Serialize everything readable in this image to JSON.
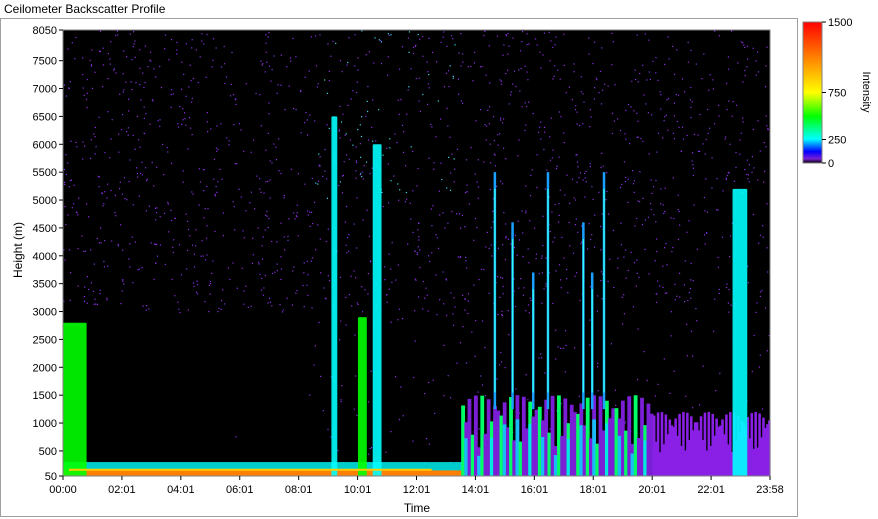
{
  "window": {
    "title": "Ceilometer Backscatter Profile"
  },
  "chart_data": {
    "type": "heatmap",
    "title": "Ceilometer Backscatter Profile",
    "xlabel": "Time",
    "ylabel": "Height (m)",
    "x_ticks": [
      "00:00",
      "02:01",
      "04:01",
      "06:01",
      "08:01",
      "10:01",
      "12:01",
      "14:01",
      "16:01",
      "18:01",
      "20:01",
      "22:01",
      "23:58"
    ],
    "y_ticks": [
      50,
      500,
      1000,
      1500,
      2000,
      2500,
      3000,
      3500,
      4000,
      4500,
      5000,
      5500,
      6000,
      6500,
      7000,
      7500,
      8050
    ],
    "ylim": [
      50,
      8050
    ],
    "xlim_hours": [
      0,
      23.97
    ],
    "colorbar": {
      "label": "Intensity",
      "ticks": [
        "1500",
        "750",
        "250",
        "0"
      ],
      "range": [
        0,
        1500
      ],
      "colors": [
        "#000000",
        "#7a1fd6",
        "#0000ff",
        "#00ffff",
        "#00ff00",
        "#ffff00",
        "#ff8000",
        "#ff0000"
      ]
    },
    "features": [
      {
        "name": "surface layer",
        "t_start": 0.0,
        "t_end": 14.0,
        "h_top": 150,
        "intensity": 900
      },
      {
        "name": "early residual plume",
        "t_start": 0.0,
        "t_end": 0.8,
        "h_top": 2800,
        "intensity": 300
      },
      {
        "name": "morning cloud base",
        "t_start": 10.0,
        "t_end": 10.3,
        "h_top": 2900,
        "intensity": 400
      },
      {
        "name": "virga streak A",
        "t_start": 9.1,
        "t_end": 9.3,
        "h_top": 6500,
        "intensity": 250
      },
      {
        "name": "virga streak B",
        "t_start": 10.5,
        "t_end": 10.8,
        "h_top": 6000,
        "intensity": 250
      },
      {
        "name": "afternoon boundary layer",
        "t_start": 13.5,
        "t_end": 20.0,
        "h_top": 1500,
        "intensity": 500
      },
      {
        "name": "afternoon convective streaks",
        "t_start": 14.5,
        "t_end": 19.0,
        "h_top": 5500,
        "intensity": 300
      },
      {
        "name": "evening residual layer",
        "t_start": 20.0,
        "t_end": 23.97,
        "h_top": 1200,
        "intensity": 60
      },
      {
        "name": "late high cloud",
        "t_start": 22.7,
        "t_end": 23.2,
        "h_top": 5200,
        "intensity": 250
      }
    ]
  }
}
